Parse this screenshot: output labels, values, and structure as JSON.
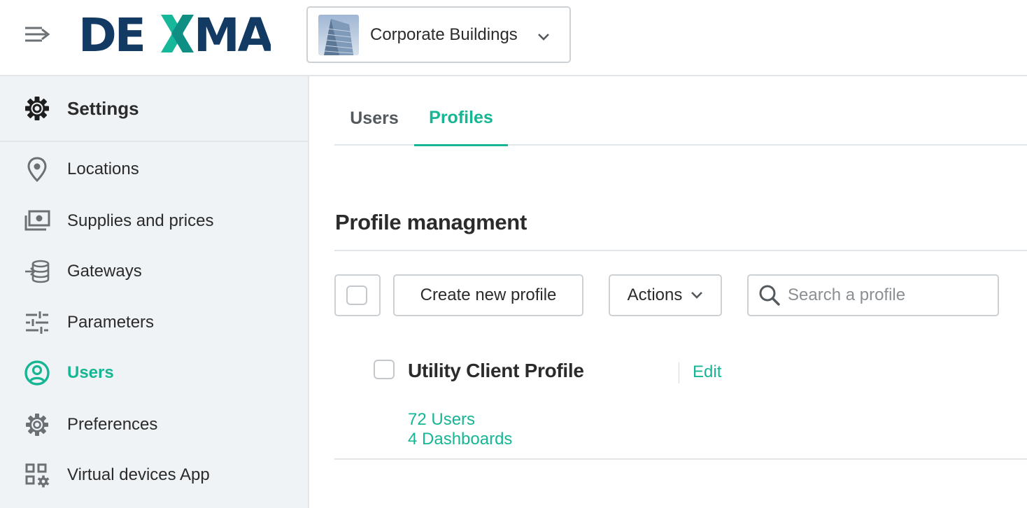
{
  "header": {
    "logo_text": "DEXMA",
    "building": {
      "name": "Corporate Buildings",
      "chevron_icon": "chevron-down-icon"
    }
  },
  "sidebar": {
    "title": "Settings",
    "items": [
      {
        "label": "Locations",
        "icon": "location-pin-icon"
      },
      {
        "label": "Supplies and prices",
        "icon": "money-bill-icon"
      },
      {
        "label": "Gateways",
        "icon": "gateway-icon"
      },
      {
        "label": "Parameters",
        "icon": "sliders-icon"
      },
      {
        "label": "Users",
        "icon": "user-circle-icon",
        "active": true
      },
      {
        "label": "Preferences",
        "icon": "gear-icon"
      },
      {
        "label": "Virtual devices App",
        "icon": "apps-gear-icon"
      }
    ]
  },
  "tabs": [
    {
      "label": "Users",
      "active": false
    },
    {
      "label": "Profiles",
      "active": true
    }
  ],
  "main": {
    "title": "Profile managment",
    "toolbar": {
      "create_label": "Create new profile",
      "actions_label": "Actions",
      "search_placeholder": "Search a profile"
    },
    "profiles": [
      {
        "name": "Utility Client Profile",
        "edit_label": "Edit",
        "users_label": "72 Users",
        "dashboards_label": "4 Dashboards"
      }
    ]
  },
  "colors": {
    "accent": "#16b694",
    "brand_navy": "#123a63",
    "sidebar_bg": "#f0f3f5",
    "border": "#cdd1d4"
  }
}
